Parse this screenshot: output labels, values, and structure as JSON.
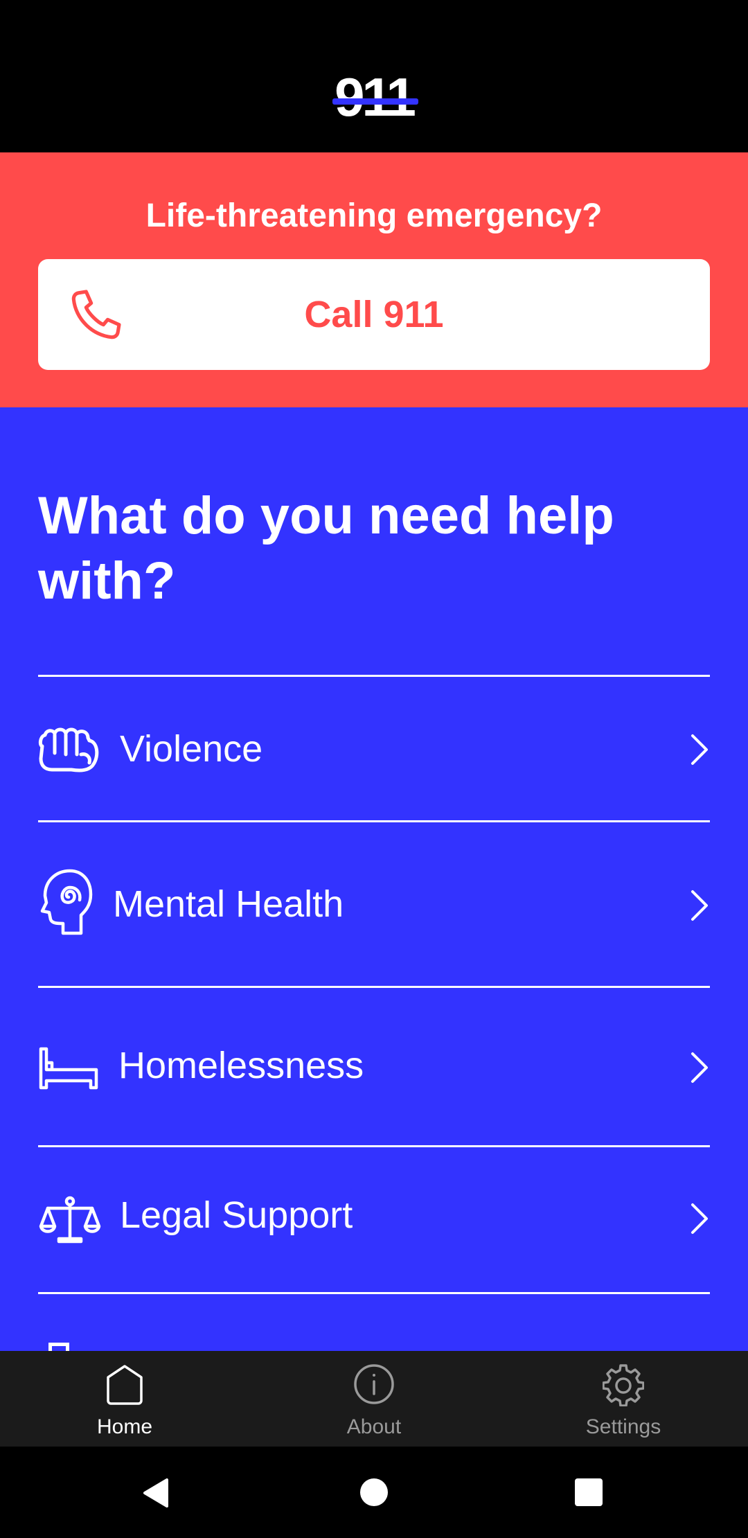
{
  "app": {
    "logo_text": "911"
  },
  "emergency": {
    "question": "Life-threatening emergency?",
    "call_label": "Call 911",
    "phone_icon": "phone-icon"
  },
  "main": {
    "title": "What do you need help with?",
    "items": [
      {
        "label": "Violence",
        "icon": "fist-icon"
      },
      {
        "label": "Mental Health",
        "icon": "head-spiral-icon"
      },
      {
        "label": "Homelessness",
        "icon": "bed-icon"
      },
      {
        "label": "Legal Support",
        "icon": "scales-icon"
      }
    ]
  },
  "bottom_nav": {
    "items": [
      {
        "label": "Home",
        "icon": "home-icon",
        "active": true
      },
      {
        "label": "About",
        "icon": "info-icon",
        "active": false
      },
      {
        "label": "Settings",
        "icon": "gear-icon",
        "active": false
      }
    ]
  },
  "system_nav": {
    "buttons": [
      "back-icon",
      "home-circle-icon",
      "recents-icon"
    ]
  },
  "colors": {
    "emergency_red": "#ff4b4b",
    "primary_blue": "#3333ff",
    "nav_bg": "#1b1b1b",
    "nav_active": "#ffffff",
    "nav_inactive": "#9a9a9a"
  }
}
